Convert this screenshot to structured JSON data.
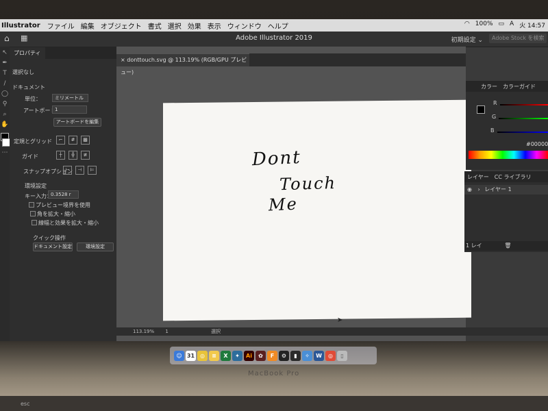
{
  "menubar": {
    "app_name": "Illustrator",
    "items": [
      "ファイル",
      "編集",
      "オブジェクト",
      "書式",
      "選択",
      "効果",
      "表示",
      "ウィンドウ",
      "ヘルプ"
    ],
    "battery": "100%",
    "input_method": "A",
    "clock": "火 14:57"
  },
  "appbar": {
    "title": "Adobe Illustrator 2019",
    "workspace": "初期設定 ⌄",
    "stock_placeholder": "Adobe Stock を検索"
  },
  "doc_tab": {
    "label": "donttouch.svg @ 113.19% (RGB/GPU プレビュー)"
  },
  "properties": {
    "tab": "プロパティ",
    "no_selection": "選択なし",
    "document_heading": "ドキュメント",
    "unit_label": "単位：",
    "unit_value": "ミリメートル",
    "artboard_label": "アートボード：",
    "artboard_value": "1",
    "edit_artboard_button": "アートボードを編集",
    "rulers_grid_label": "定規とグリッド",
    "guides_label": "ガイド",
    "snap_label": "スナップオプション",
    "prefs_heading": "環境設定",
    "key_increment_label": "キー入力：",
    "key_increment_value": "0.3528 r",
    "check_preview_bounds": "プレビュー境界を使用",
    "check_scale_corners": "角を拡大・縮小",
    "check_scale_strokes": "線幅と効果を拡大・縮小",
    "quick_actions_heading": "クイック操作",
    "doc_setup_button": "ドキュメント設定",
    "prefs_button": "環境設定"
  },
  "artboard_text": {
    "line1": "Dont",
    "line2": "Touch",
    "line3": "Me"
  },
  "color_panel": {
    "tab_color": "カラー",
    "tab_guide": "カラーガイド",
    "r_label": "R",
    "g_label": "G",
    "b_label": "B",
    "hex_value": "000000"
  },
  "layers_panel": {
    "tab_layers": "レイヤー",
    "tab_cc": "CC ライブラリ",
    "layer_name": "レイヤー 1",
    "footer": "1 レイ"
  },
  "statusbar": {
    "zoom": "113.19%",
    "artboard_num": "1",
    "mode": "選択"
  },
  "dock": {
    "calendar_day": "31",
    "ai_label": "Ai"
  },
  "laptop": {
    "label": "MacBook Pro",
    "esc_key": "esc"
  }
}
